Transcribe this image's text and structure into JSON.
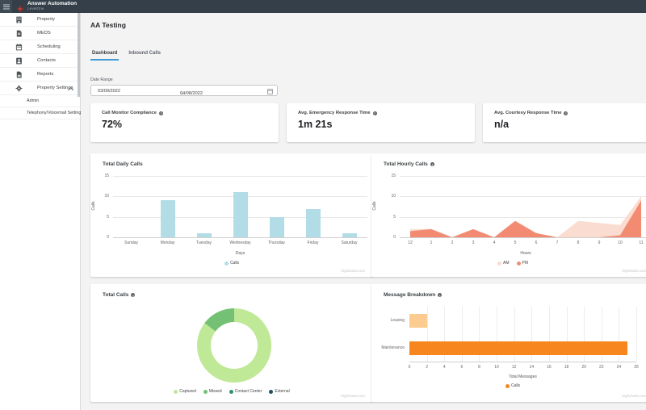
{
  "header": {
    "title": "Answer Automation",
    "subtitle": "LevelOne"
  },
  "sidebar": {
    "items": [
      {
        "label": "Property",
        "icon": "building"
      },
      {
        "label": "MEDS",
        "icon": "document"
      },
      {
        "label": "Scheduling",
        "icon": "calendar"
      },
      {
        "label": "Contacts",
        "icon": "contacts"
      },
      {
        "label": "Reports",
        "icon": "report"
      },
      {
        "label": "Property Settings",
        "icon": "gear",
        "chevron": "up"
      },
      {
        "label": "Admin",
        "sub": true
      },
      {
        "label": "Telephony/Voicemail Settings",
        "sub": true
      }
    ]
  },
  "page": {
    "title": "AA Testing",
    "tabs": [
      {
        "label": "Dashboard",
        "active": true
      },
      {
        "label": "Inbound Calls",
        "active": false
      }
    ]
  },
  "filters": {
    "label": "Date Range",
    "start": "03/09/2022",
    "separator": "→",
    "end": "04/08/2022"
  },
  "kpis": [
    {
      "label": "Call Monitor Compliance",
      "value": "72%"
    },
    {
      "label": "Avg. Emergency Response Time",
      "value": "1m 21s"
    },
    {
      "label": "Avg. Courtesy Response Time",
      "value": "n/a"
    }
  ],
  "chart_data": [
    {
      "type": "bar",
      "title": "Total Daily Calls",
      "info": false,
      "categories": [
        "Sunday",
        "Monday",
        "Tuesday",
        "Wednesday",
        "Thursday",
        "Friday",
        "Saturday"
      ],
      "series": [
        {
          "name": "Calls",
          "values": [
            0,
            9,
            1,
            11,
            5,
            7,
            1
          ],
          "color": "#b3dde6"
        }
      ],
      "xlabel": "Days",
      "ylabel": "Calls",
      "ylim": [
        0,
        15
      ],
      "yticks": [
        0,
        5,
        10,
        15
      ],
      "legend_position": "bottom"
    },
    {
      "type": "area",
      "title": "Total Hourly Calls",
      "info": true,
      "categories": [
        "12",
        "1",
        "2",
        "3",
        "4",
        "5",
        "6",
        "7",
        "8",
        "9",
        "10",
        "11"
      ],
      "series": [
        {
          "name": "AM",
          "values": [
            2,
            2,
            0,
            2,
            0,
            4,
            1,
            0,
            4,
            3.5,
            3,
            10
          ],
          "color": "#fbdcd0"
        },
        {
          "name": "PM",
          "values": [
            1.5,
            2,
            0,
            2,
            0,
            4,
            1,
            0,
            0,
            0,
            0.5,
            9
          ],
          "color": "#f28b72"
        }
      ],
      "xlabel": "Hours",
      "ylabel": "Calls",
      "ylim": [
        0,
        15
      ],
      "yticks": [
        0,
        5,
        10,
        15
      ],
      "legend_position": "bottom"
    },
    {
      "type": "donut",
      "title": "Total Calls",
      "info": true,
      "series": [
        {
          "name": "Captured",
          "value": 29,
          "color": "#bfe897"
        },
        {
          "name": "Missed",
          "value": 5,
          "color": "#74c175"
        },
        {
          "name": "Contact Center",
          "value": 0,
          "color": "#2e9468"
        },
        {
          "name": "External",
          "value": 0,
          "color": "#20505f"
        }
      ],
      "legend_position": "bottom"
    },
    {
      "type": "hbar",
      "title": "Message Breakdown",
      "info": true,
      "categories": [
        "Leasing",
        "Maintenance"
      ],
      "series": [
        {
          "name": "Calls",
          "values": [
            2,
            25
          ],
          "colors": [
            "#fbcb8f",
            "#f8861e"
          ],
          "color": "#f8861e"
        }
      ],
      "xlabel": "Total Messages",
      "xlim": [
        0,
        26
      ],
      "xticks": [
        0,
        2,
        4,
        6,
        8,
        10,
        12,
        14,
        16,
        18,
        20,
        22,
        24,
        26
      ],
      "legend_position": "bottom"
    }
  ],
  "watermark": "Highcharts.com",
  "colors": {
    "header_bg": "#343f49",
    "tab_accent": "#3f9ad6",
    "main_bg": "#f3f3f4"
  }
}
